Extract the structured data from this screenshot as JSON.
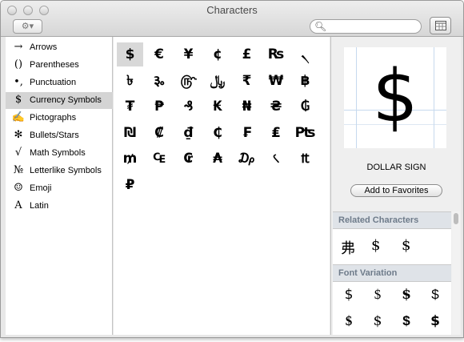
{
  "window": {
    "title": "Characters"
  },
  "toolbar": {
    "action_label": "⚙▾",
    "search_placeholder": ""
  },
  "sidebar": {
    "items": [
      {
        "icon": "→",
        "label": "Arrows",
        "icon_name": "arrow-icon"
      },
      {
        "icon": "()",
        "label": "Parentheses",
        "icon_name": "parentheses-icon"
      },
      {
        "icon": "•,",
        "label": "Punctuation",
        "icon_name": "punctuation-icon"
      },
      {
        "icon": "$",
        "label": "Currency Symbols",
        "icon_name": "currency-icon",
        "selected": true
      },
      {
        "icon": "✍",
        "label": "Pictographs",
        "icon_name": "pictograph-icon"
      },
      {
        "icon": "✻",
        "label": "Bullets/Stars",
        "icon_name": "bullet-star-icon"
      },
      {
        "icon": "√",
        "label": "Math Symbols",
        "icon_name": "math-icon"
      },
      {
        "icon": "№",
        "label": "Letterlike Symbols",
        "icon_name": "letterlike-icon"
      },
      {
        "icon": "☺",
        "label": "Emoji",
        "icon_name": "emoji-icon"
      },
      {
        "icon": "A",
        "label": "Latin",
        "icon_name": "latin-icon"
      }
    ]
  },
  "characters": [
    "$",
    "€",
    "¥",
    "¢",
    "£",
    "₨",
    "৲",
    "৳",
    "૱",
    "௹",
    "﷼",
    "₹",
    "₩",
    "฿",
    "₮",
    "₱",
    "₰",
    "₭",
    "₦",
    "₴",
    "₲",
    "₪",
    "₡",
    "₫",
    "₵",
    "₣",
    "₤",
    "₧",
    "₥",
    "₠",
    "₢",
    "₳",
    "₯",
    "৻",
    "₶",
    "₽"
  ],
  "selected_index": 0,
  "preview": {
    "glyph": "$",
    "name": "DOLLAR SIGN",
    "favorites_label": "Add to Favorites"
  },
  "related": {
    "title": "Related Characters",
    "chars": [
      "弗",
      "$",
      "$"
    ]
  },
  "variation": {
    "title": "Font Variation",
    "chars": [
      "$",
      "$",
      "$",
      "$",
      "$",
      "$",
      "$",
      "$"
    ]
  },
  "colors": {
    "selection": "#d4d4d4",
    "section_header": "#dfe3e8",
    "section_text": "#6e7b8a"
  }
}
